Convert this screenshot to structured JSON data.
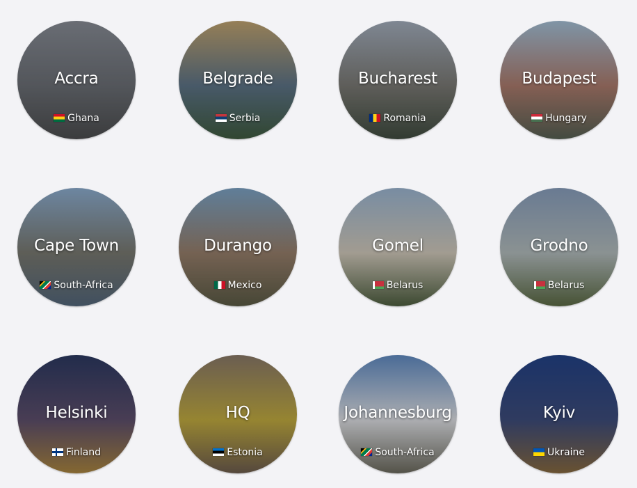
{
  "cities": [
    {
      "name": "Accra",
      "country": "Ghana",
      "flag": "f-gh",
      "colors": [
        "#8a8f96",
        "#6b6f73",
        "#4a4b4a"
      ]
    },
    {
      "name": "Belgrade",
      "country": "Serbia",
      "flag": "f-rs",
      "colors": [
        "#c7a86e",
        "#5c7486",
        "#3c5a3a"
      ]
    },
    {
      "name": "Bucharest",
      "country": "Romania",
      "flag": "f-ro",
      "colors": [
        "#a8b3c0",
        "#7b7a72",
        "#3d4a3a"
      ]
    },
    {
      "name": "Budapest",
      "country": "Hungary",
      "flag": "f-hu",
      "colors": [
        "#a9c6dc",
        "#b07c6a",
        "#55604f"
      ]
    },
    {
      "name": "Cape Town",
      "country": "South-Africa",
      "flag": "f-za",
      "colors": [
        "#8fb2d4",
        "#7a7a6e",
        "#52677a"
      ]
    },
    {
      "name": "Durango",
      "country": "Mexico",
      "flag": "f-mx",
      "colors": [
        "#7da7c9",
        "#9a8068",
        "#5a5a40"
      ]
    },
    {
      "name": "Gomel",
      "country": "Belarus",
      "flag": "f-by",
      "colors": [
        "#9fbbd6",
        "#d8d0be",
        "#4c5e3a"
      ]
    },
    {
      "name": "Grodno",
      "country": "Belarus",
      "flag": "f-by",
      "colors": [
        "#8aa2c0",
        "#b8c2c0",
        "#5a6a3e"
      ]
    },
    {
      "name": "Helsinki",
      "country": "Finland",
      "flag": "f-fi",
      "colors": [
        "#27355e",
        "#5d4d6a",
        "#b0883a"
      ]
    },
    {
      "name": "HQ",
      "country": "Estonia",
      "flag": "f-ee",
      "colors": [
        "#8c7a66",
        "#c8b03a",
        "#6e5c4a"
      ]
    },
    {
      "name": "Johannesburg",
      "country": "South-Africa",
      "flag": "f-za",
      "colors": [
        "#5f8dc6",
        "#e6e8ea",
        "#6c6a5a"
      ]
    },
    {
      "name": "Kyiv",
      "country": "Ukraine",
      "flag": "f-ua",
      "colors": [
        "#1d3f86",
        "#3a4a7a",
        "#8a6a3a"
      ]
    }
  ]
}
